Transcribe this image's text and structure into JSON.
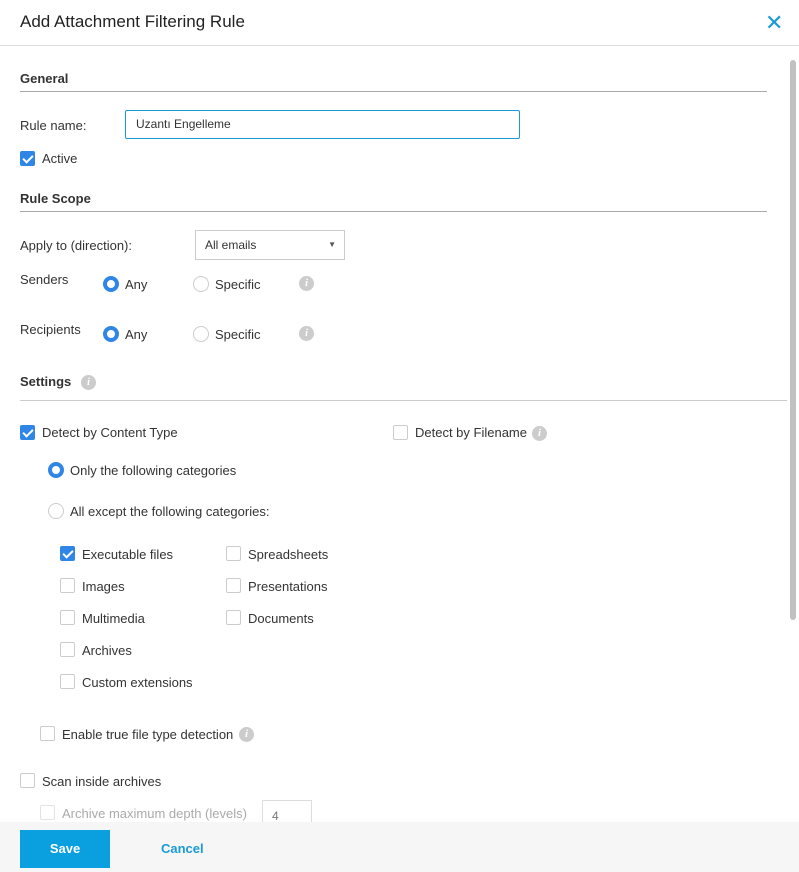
{
  "dialog": {
    "title": "Add Attachment Filtering Rule",
    "close_icon": "close-icon"
  },
  "general": {
    "heading": "General",
    "rule_name_label": "Rule name:",
    "rule_name_value": "Uzantı Engelleme",
    "active_label": "Active",
    "active_checked": true
  },
  "scope": {
    "heading": "Rule Scope",
    "apply_label": "Apply to (direction):",
    "apply_value": "All emails",
    "senders": {
      "label": "Senders",
      "any": "Any",
      "specific": "Specific",
      "selected": "Any"
    },
    "recipients": {
      "label": "Recipients",
      "any": "Any",
      "specific": "Specific",
      "selected": "Any"
    }
  },
  "settings": {
    "heading": "Settings",
    "detect_content": "Detect by Content Type",
    "detect_content_checked": true,
    "detect_filename": "Detect by Filename",
    "detect_filename_checked": false,
    "only_following": "Only the following categories",
    "all_except": "All except the following categories:",
    "mode": "only",
    "categories": [
      {
        "label": "Executable files",
        "checked": true
      },
      {
        "label": "Images",
        "checked": false
      },
      {
        "label": "Multimedia",
        "checked": false
      },
      {
        "label": "Archives",
        "checked": false
      },
      {
        "label": "Custom extensions",
        "checked": false
      },
      {
        "label": "Spreadsheets",
        "checked": false
      },
      {
        "label": "Presentations",
        "checked": false
      },
      {
        "label": "Documents",
        "checked": false
      }
    ],
    "true_type": "Enable true file type detection",
    "scan_archives": "Scan inside archives",
    "archive_depth": "Archive maximum depth (levels)",
    "archive_depth_value": "4"
  },
  "footer": {
    "save": "Save",
    "cancel": "Cancel"
  },
  "colors": {
    "accent": "#0aa0e0",
    "check": "#2f86e6"
  }
}
